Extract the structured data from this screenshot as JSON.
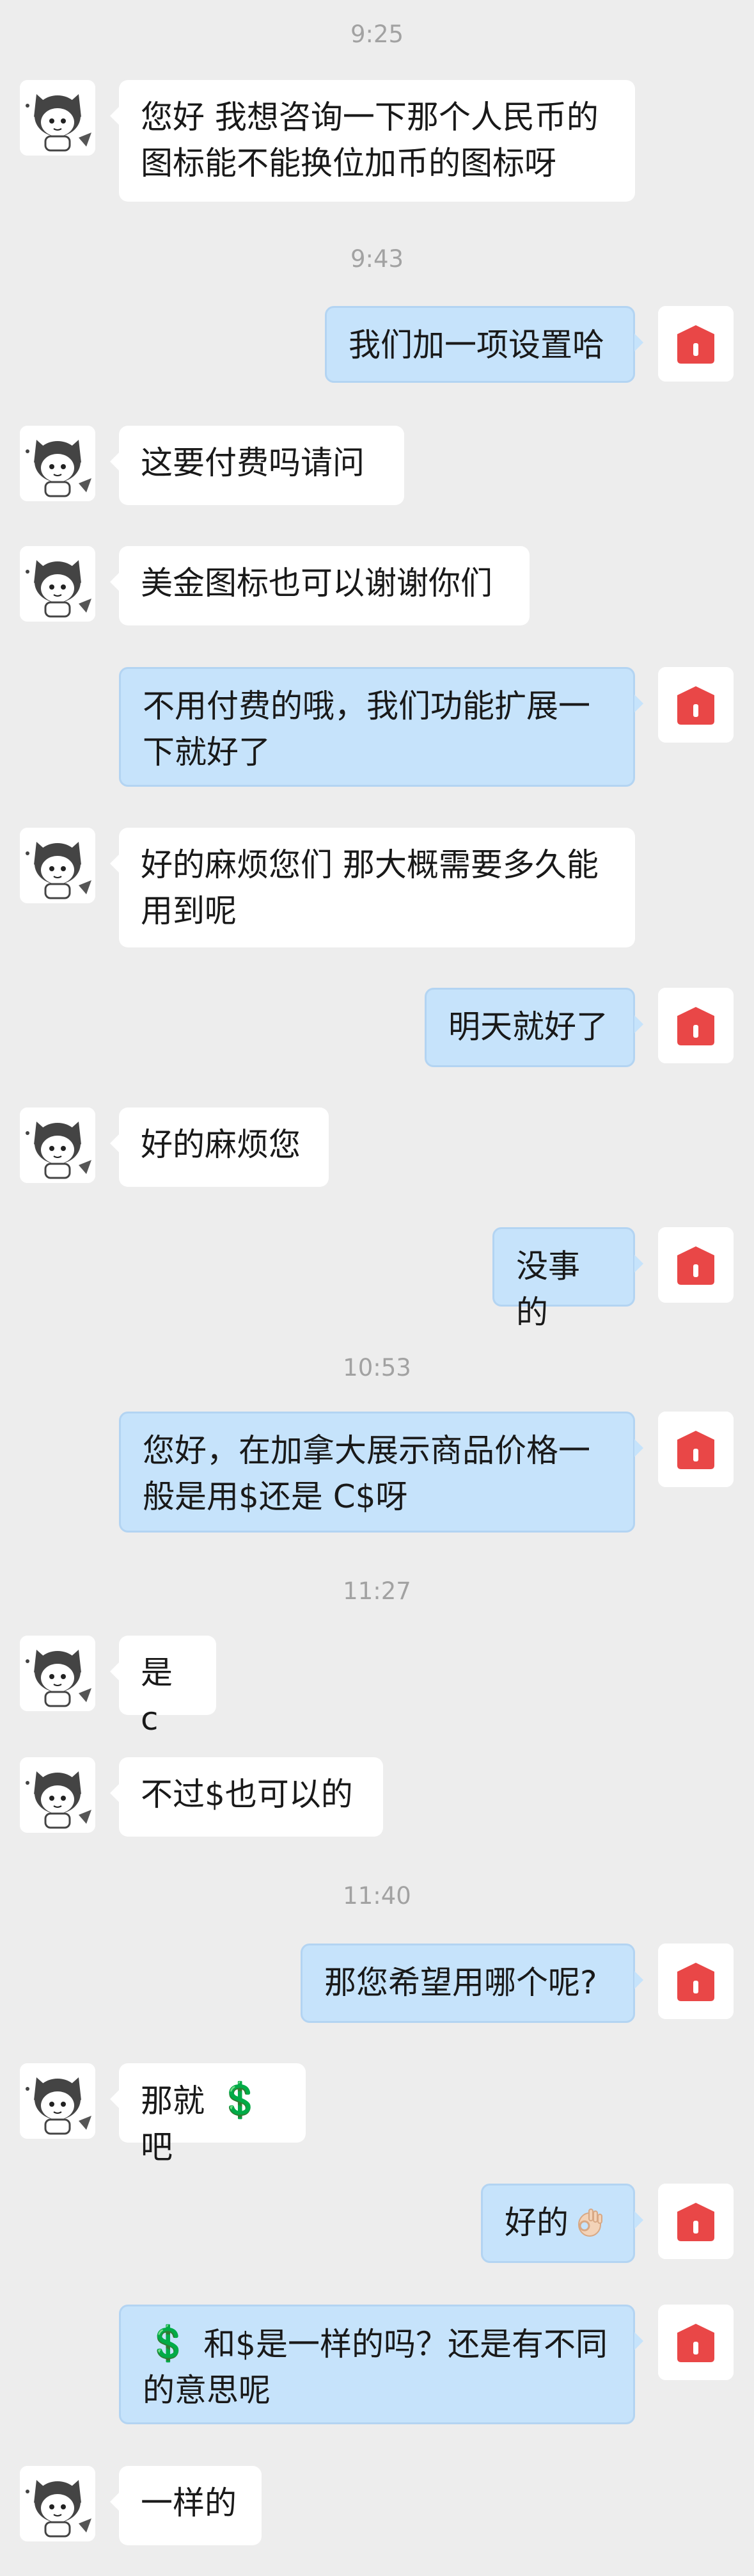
{
  "timestamps": [
    "9:25",
    "9:43",
    "10:53",
    "11:27",
    "11:40"
  ],
  "messages": [
    {
      "id": "m1",
      "from": "customer",
      "text": "您好 我想咨询一下那个人民币的图标能不能换位加币的图标呀"
    },
    {
      "id": "m2",
      "from": "me",
      "text": "我们加一项设置哈"
    },
    {
      "id": "m3",
      "from": "customer",
      "text": " 这要付费吗请问"
    },
    {
      "id": "m4",
      "from": "customer",
      "text": "美金图标也可以谢谢你们"
    },
    {
      "id": "m5",
      "from": "me",
      "text": "不用付费的哦，我们功能扩展一下就好了"
    },
    {
      "id": "m6",
      "from": "customer",
      "text": "好的麻烦您们 那大概需要多久能用到呢"
    },
    {
      "id": "m7",
      "from": "me",
      "text": "明天就好了"
    },
    {
      "id": "m8",
      "from": "customer",
      "text": "好的麻烦您"
    },
    {
      "id": "m9",
      "from": "me",
      "text": "没事的"
    },
    {
      "id": "m10",
      "from": "me",
      "text": "您好，在加拿大展示商品价格一般是用$还是 C$呀"
    },
    {
      "id": "m11",
      "from": "customer",
      "text": "是 c"
    },
    {
      "id": "m12",
      "from": "customer",
      "text": "不过$也可以的"
    },
    {
      "id": "m13",
      "from": "me",
      "text": "那您希望用哪个呢?"
    },
    {
      "id": "m14",
      "from": "customer",
      "pre": "那就 ",
      "emoji": "💲",
      "post": " 吧"
    },
    {
      "id": "m15",
      "from": "me",
      "text": "好的",
      "emoji": "ok-hand"
    },
    {
      "id": "m16",
      "from": "me",
      "emoji": "💲",
      "post": " 和$是一样的吗？还是有不同的意思呢"
    },
    {
      "id": "m17",
      "from": "customer",
      "text": "一样的"
    }
  ],
  "colors": {
    "background": "#ededed",
    "incoming_bubble": "#ffffff",
    "outgoing_bubble": "#c6e3fb",
    "shop_avatar": "#e94747",
    "timestamp": "#a2a2a2"
  },
  "icons": {
    "customer_avatar": "cartoon-wolf-hood-avatar",
    "shop_avatar": "red-house-logo"
  }
}
